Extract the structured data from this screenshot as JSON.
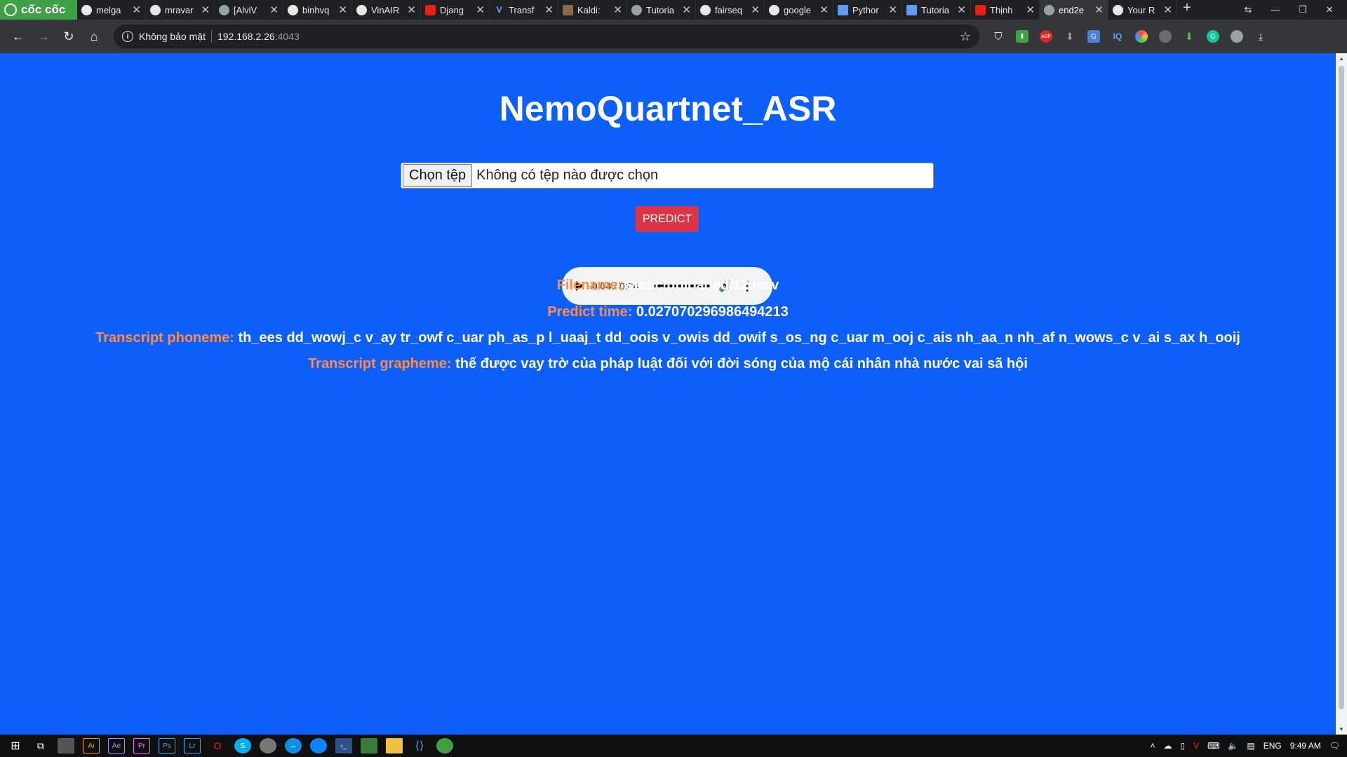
{
  "browser": {
    "brand": "cốc cốc",
    "tabs": [
      {
        "title": "melga",
        "favicon": "github-icon"
      },
      {
        "title": "mravar",
        "favicon": "github-icon"
      },
      {
        "title": "[AlviV",
        "favicon": "globe-icon"
      },
      {
        "title": "binhvq",
        "favicon": "github-icon"
      },
      {
        "title": "VinAIR",
        "favicon": "github-icon"
      },
      {
        "title": "Djang",
        "favicon": "youtube-icon"
      },
      {
        "title": "Transf",
        "favicon": "v-icon"
      },
      {
        "title": "Kaldi:",
        "favicon": "image-icon"
      },
      {
        "title": "Tutoria",
        "favicon": "globe-icon"
      },
      {
        "title": "fairseq",
        "favicon": "github-icon"
      },
      {
        "title": "google",
        "favicon": "github-icon"
      },
      {
        "title": "Pythor",
        "favicon": "doc-icon"
      },
      {
        "title": "Tutoria",
        "favicon": "doc-icon"
      },
      {
        "title": "Thịnh",
        "favicon": "youtube-icon"
      },
      {
        "title": "end2e",
        "favicon": "globe-icon",
        "active": true
      },
      {
        "title": "Your R",
        "favicon": "github-icon"
      }
    ],
    "omnibox": {
      "security_label": "Không bảo mật",
      "host": "192.168.2.26",
      "port": ":4043"
    }
  },
  "page": {
    "title": "NemoQuartnet_ASR",
    "file_input": {
      "button_label": "Chọn tệp",
      "status": "Không có tệp nào được chọn"
    },
    "predict_label": "PREDICT",
    "audio": {
      "time": "0:04 / 0:04",
      "progress": 1.0
    },
    "results": [
      {
        "label": "Filename:",
        "value": "static/uploaded/12.wav"
      },
      {
        "label": "Predict time:",
        "value": "0.027070296986494213"
      },
      {
        "label": "Transcript phoneme:",
        "value": "th_ees dd_wowj_c v_ay tr_owf c_uar ph_as_p l_uaaj_t dd_oois v_owis dd_owif s_os_ng c_uar m_ooj c_ais nh_aa_n nh_af n_wows_c v_ai s_ax h_ooij"
      },
      {
        "label": "Transcript grapheme:",
        "value": "thế được vay trờ của pháp luật đối với đời sóng của mộ cái nhân nhà nước vai sã hội"
      }
    ]
  },
  "taskbar": {
    "language": "ENG",
    "clock": "9:49 AM"
  },
  "colors": {
    "page_background": "#0d5ffc",
    "predict_button": "#dc3545",
    "result_label": "#ff8c42",
    "brand_green": "#3fa046"
  }
}
